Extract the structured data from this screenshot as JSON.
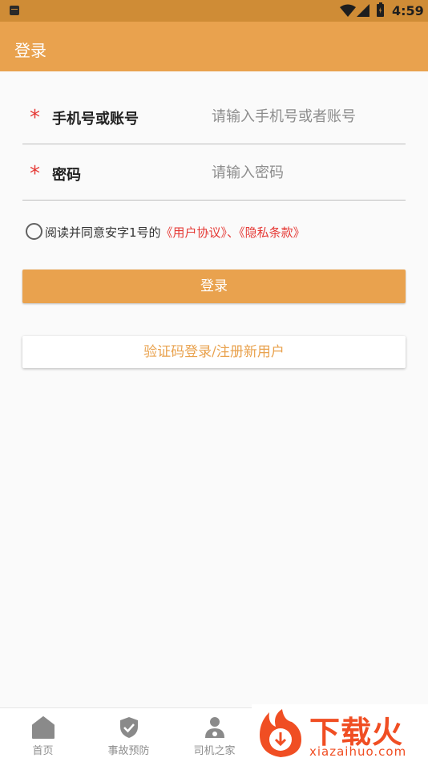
{
  "status_bar": {
    "time": "4:59"
  },
  "app_bar": {
    "title": "登录"
  },
  "form": {
    "required_mark": "*",
    "phone": {
      "label": "手机号或账号",
      "placeholder": "请输入手机号或者账号",
      "value": ""
    },
    "password": {
      "label": "密码",
      "placeholder": "请输入密码",
      "value": ""
    }
  },
  "agreement": {
    "checked": false,
    "prefix": "阅读并同意安字1号的",
    "user_agreement": "《用户协议》",
    "separator": "、",
    "privacy_policy": "《隐私条款》"
  },
  "buttons": {
    "login": "登录",
    "code_login": "验证码登录/注册新用户"
  },
  "bottom_nav": [
    {
      "label": "首页",
      "icon": "home-icon"
    },
    {
      "label": "事故预防",
      "icon": "shield-icon"
    },
    {
      "label": "司机之家",
      "icon": "driver-icon"
    }
  ],
  "watermark": {
    "title": "下载火",
    "subtitle": "xiazaihuo.com"
  },
  "colors": {
    "accent": "#e9a24e",
    "status_bar": "#cf8c36",
    "required": "#e53935",
    "link": "#e53935",
    "watermark": "#f04e23"
  }
}
